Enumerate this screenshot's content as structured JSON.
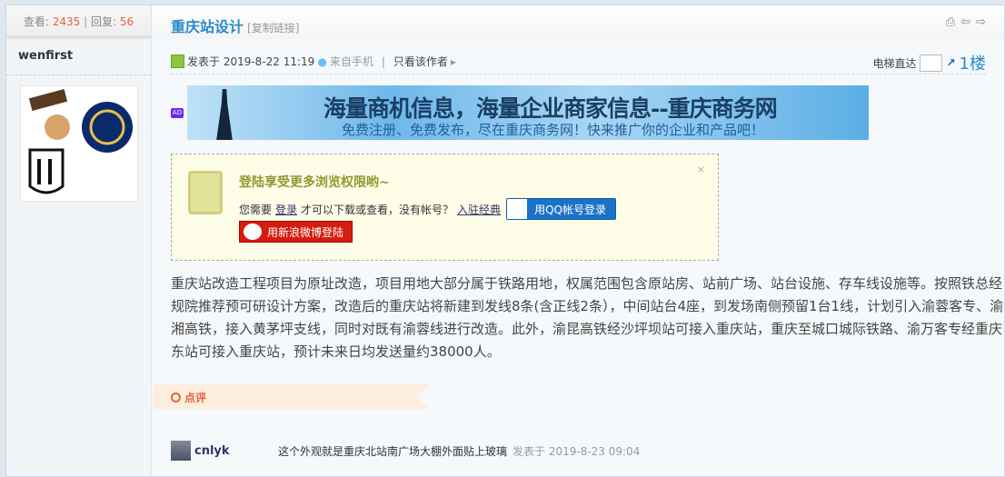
{
  "sidebar": {
    "views_label": "查看:",
    "views": "2435",
    "replies_label": "回复:",
    "replies": "56",
    "username": "wenfirst"
  },
  "thread": {
    "title": "重庆站设计",
    "copy_link": "[复制链接]"
  },
  "toolbar": {
    "print_icon": "⎙",
    "prev_icon": "⇦",
    "next_icon": "⇨"
  },
  "post": {
    "posted_at": "发表于 2019-8-22 11:19",
    "from_mobile": "来自手机",
    "only_author": "只看该作者",
    "elevator_label": "电梯直达",
    "floor": "1楼"
  },
  "ad": {
    "badge": "AD",
    "headline": "海量商机信息，海量企业商家信息--重庆商务网",
    "subline": "免费注册、免费发布，尽在重庆商务网！快来推广你的企业和产品吧！"
  },
  "login_box": {
    "heading": "登陆享受更多浏览权限哟~",
    "prefix": "您需要",
    "login_link": "登录",
    "middle": "才可以下载或查看，没有帐号？",
    "register_link": "入驻经典",
    "qq_button": "用QQ帐号登录",
    "weibo_button": "用新浪微博登陆",
    "close": "×"
  },
  "content": "重庆站改造工程项目为原址改造，项目用地大部分属于铁路用地，权属范围包含原站房、站前广场、站台设施、存车线设施等。按照铁总经规院推荐预可研设计方案，改造后的重庆站将新建到发线8条(含正线2条），中间站台4座，到发场南侧预留1台1线，计划引入渝蓉客专、渝湘高铁，接入黄茅坪支线，同时对既有渝蓉线进行改造。此外，渝昆高铁经沙坪坝站可接入重庆站，重庆至城口城际铁路、渝万客专经重庆东站可接入重庆站，预计未来日均发送量约38000人。",
  "comments": {
    "label": "点评",
    "items": [
      {
        "user": "cnlyk",
        "text": "这个外观就是重庆北站南广场大棚外面贴上玻璃",
        "time": "发表于 2019-8-23 09:04"
      }
    ]
  }
}
